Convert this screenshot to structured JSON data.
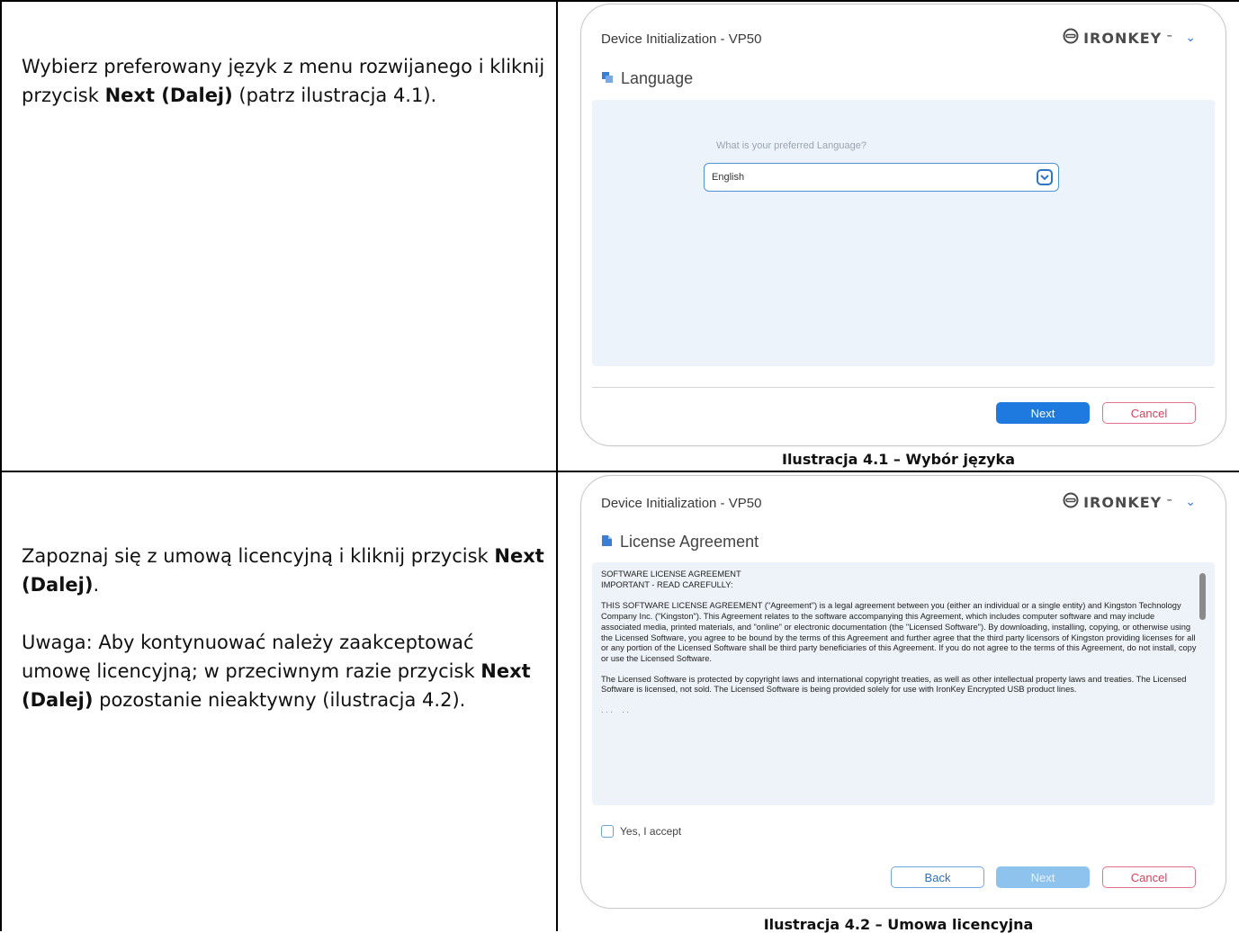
{
  "rows": [
    {
      "instruction": {
        "part1": "Wybierz preferowany język z menu rozwijanego i kliknij przycisk ",
        "bold": "Next (Dalej)",
        "part2": " (patrz ilustracja 4.1)."
      },
      "caption": "Ilustracja 4.1 – Wybór języka",
      "window": {
        "title": "Device Initialization - VP50",
        "brand": "IRONKEY",
        "section_title": "Language",
        "question": "What is your preferred Language?",
        "selected_language": "English",
        "next_label": "Next",
        "cancel_label": "Cancel"
      }
    },
    {
      "instruction": {
        "p1_part1": "Zapoznaj się z umową licencyjną i kliknij przycisk ",
        "p1_bold": "Next (Dalej)",
        "p1_part2": ".",
        "p2_part1": "Uwaga: Aby kontynuować należy zaakceptować umowę licencyjną; w przeciwnym razie przycisk ",
        "p2_bold": "Next (Dalej)",
        "p2_part2": " pozostanie nieaktywny (ilustracja 4.2)."
      },
      "caption": "Ilustracja 4.2 – Umowa licencyjna",
      "window": {
        "title": "Device Initialization - VP50",
        "brand": "IRONKEY",
        "section_title": "License Agreement",
        "license_heading1": "SOFTWARE LICENSE AGREEMENT",
        "license_heading2": "IMPORTANT - READ CAREFULLY:",
        "license_para1": "THIS SOFTWARE LICENSE AGREEMENT (\"Agreement\") is a legal agreement between you (either an individual or a single entity) and Kingston Technology Company Inc. (\"Kingston\"). This Agreement relates to the software accompanying this Agreement, which includes computer software and may include associated media, printed materials, and \"online\" or electronic documentation (the \"Licensed Software\"). By downloading, installing, copying, or otherwise using the Licensed Software, you agree to be bound by the terms of this Agreement and further agree that the third party licensors of Kingston providing licenses for all or any portion of the Licensed Software shall be third party beneficiaries of this Agreement. If you do not agree to the terms of this Agreement, do not install, copy or use the Licensed Software.",
        "license_para2": "The Licensed Software is protected by copyright laws and international copyright treaties, as well as other intellectual property laws and treaties. The Licensed Software is licensed, not sold. The Licensed Software is being provided solely for use with IronKey Encrypted USB product lines.",
        "accept_label": "Yes, I accept",
        "back_label": "Back",
        "next_label": "Next",
        "cancel_label": "Cancel"
      }
    }
  ],
  "colors": {
    "accent": "#1f7ae0",
    "next_disabled": "#8ec3ee",
    "cancel": "#d2425e",
    "panel": "#edf3fb"
  }
}
